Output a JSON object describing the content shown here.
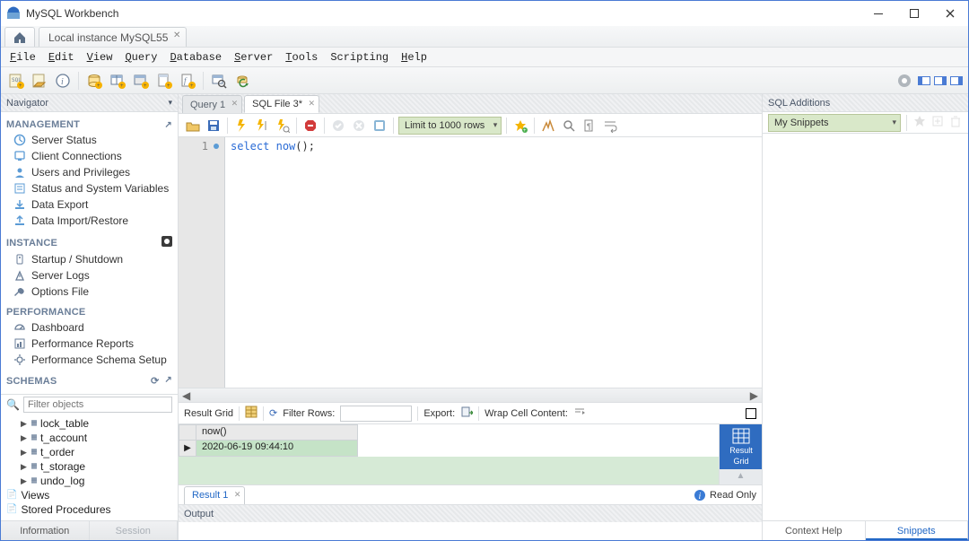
{
  "titlebar": {
    "app_title": "MySQL Workbench"
  },
  "conn_tab": {
    "label": "Local instance MySQL55"
  },
  "menu": {
    "file": "File",
    "edit": "Edit",
    "view": "View",
    "query": "Query",
    "database": "Database",
    "server": "Server",
    "tools": "Tools",
    "scripting": "Scripting",
    "help": "Help"
  },
  "navigator": {
    "title": "Navigator",
    "management_heading": "MANAGEMENT",
    "items_management": [
      "Server Status",
      "Client Connections",
      "Users and Privileges",
      "Status and System Variables",
      "Data Export",
      "Data Import/Restore"
    ],
    "instance_heading": "INSTANCE",
    "items_instance": [
      "Startup / Shutdown",
      "Server Logs",
      "Options File"
    ],
    "performance_heading": "PERFORMANCE",
    "items_performance": [
      "Dashboard",
      "Performance Reports",
      "Performance Schema Setup"
    ],
    "schemas_heading": "SCHEMAS",
    "filter_placeholder": "Filter objects",
    "schema_nodes": [
      "lock_table",
      "t_account",
      "t_order",
      "t_storage",
      "undo_log",
      "Views",
      "Stored Procedures"
    ],
    "bottom_tabs": {
      "left": "Information",
      "right": "Session"
    }
  },
  "editor": {
    "tabs": {
      "inactive": "Query 1",
      "active": "SQL File 3*"
    },
    "limit_label": "Limit to 1000 rows",
    "line_no": "1",
    "code_kw1": "select",
    "code_fn": "now",
    "code_suffix": "();"
  },
  "resultbar": {
    "grid_label": "Result Grid",
    "filter_label": "Filter Rows:",
    "export_label": "Export:",
    "wrap_label": "Wrap Cell Content:"
  },
  "result": {
    "col_header": "now()",
    "row_value": "2020-06-19 09:44:10",
    "action_line1": "Result",
    "action_line2": "Grid"
  },
  "bottom_tabs": {
    "result_tab": "Result 1",
    "readonly": "Read Only"
  },
  "output": {
    "title": "Output"
  },
  "additions": {
    "title": "SQL Additions",
    "snippets_label": "My Snippets",
    "tab_left": "Context Help",
    "tab_right": "Snippets"
  }
}
